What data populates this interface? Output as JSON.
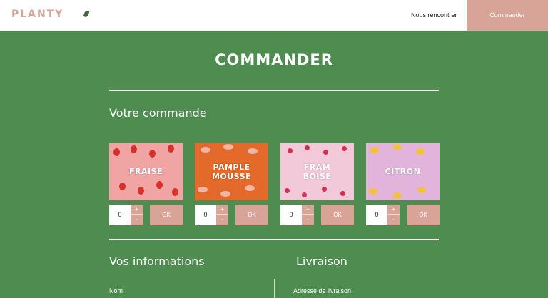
{
  "header": {
    "logo": "PLANTY",
    "nav": {
      "about": "Nous rencontrer",
      "order": "Commander"
    }
  },
  "page": {
    "title": "COMMANDER"
  },
  "order_section": {
    "title": "Votre commande"
  },
  "products": [
    {
      "name_line1": "FRAISE",
      "name_line2": "",
      "qty": "0",
      "plus": "+",
      "minus": "-",
      "ok": "OK",
      "bg": "#f0a4a4",
      "accent": "#d8322a"
    },
    {
      "name_line1": "PAMPLE",
      "name_line2": "MOUSSE",
      "qty": "0",
      "plus": "+",
      "minus": "-",
      "ok": "OK",
      "bg": "#e36a2a",
      "accent": "#f2b4a4"
    },
    {
      "name_line1": "FRAM",
      "name_line2": "BOISE",
      "qty": "0",
      "plus": "+",
      "minus": "-",
      "ok": "OK",
      "bg": "#f1c9d9",
      "accent": "#d42f50"
    },
    {
      "name_line1": "CITRON",
      "name_line2": "",
      "qty": "0",
      "plus": "+",
      "minus": "-",
      "ok": "OK",
      "bg": "#e2b4dc",
      "accent": "#f2c23e"
    }
  ],
  "info_section": {
    "title": "Vos informations",
    "name_label": "Nom"
  },
  "delivery_section": {
    "title": "Livraison",
    "address_label": "Adresse de livraison"
  },
  "colors": {
    "green": "#4f8c4f",
    "pink": "#d7a497",
    "white": "#ffffff"
  }
}
